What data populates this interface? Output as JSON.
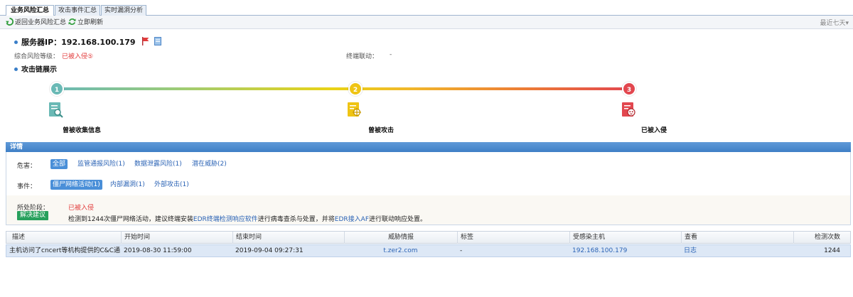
{
  "tabs": [
    {
      "label": "业务风险汇总",
      "active": true
    },
    {
      "label": "攻击事件汇总",
      "active": false
    },
    {
      "label": "实时漏洞分析",
      "active": false
    }
  ],
  "toolbar": {
    "back_label": "返回业务风险汇总",
    "refresh_label": "立即刷新",
    "range_label": "最近七天▾"
  },
  "server": {
    "title_prefix": "服务器IP：",
    "ip": "192.168.100.179",
    "risk_label": "综合风险等级：",
    "risk_value": "已被入侵⑤",
    "terminal_label": "终端联动：",
    "terminal_value": "-"
  },
  "attack_chain": {
    "title": "攻击链展示",
    "stages": [
      {
        "num": "1",
        "label": "曾被收集信息",
        "color": "#6ab9b5"
      },
      {
        "num": "2",
        "label": "曾被攻击",
        "color": "#efc414"
      },
      {
        "num": "3",
        "label": "已被入侵",
        "color": "#e2474f"
      }
    ]
  },
  "details": {
    "header": "详情",
    "harm_label": "危害：",
    "harm_options": [
      "全部",
      "监管通报风险(1)",
      "数据泄露风险(1)",
      "潜在威胁(2)"
    ],
    "event_label": "事件：",
    "event_options": [
      "僵尸网络活动(1)",
      "内部漏洞(1)",
      "外部攻击(1)"
    ],
    "stage_label": "所处阶段：",
    "stage_value": "已被入侵",
    "advice_button": "解决建议",
    "advice_text_1": "检测到1244次僵尸网络活动，建议终端安装",
    "advice_link_1": "EDR终端检测响应软件",
    "advice_text_2": "进行病毒查杀与处置，并将",
    "advice_link_2": "EDR接入AF",
    "advice_text_3": "进行联动响应处置。"
  },
  "table": {
    "columns": [
      "描述",
      "开始时间",
      "结束时间",
      "威胁情报",
      "标签",
      "受感染主机",
      "查看",
      "检测次数"
    ],
    "rows": [
      {
        "desc": "主机访问了cncert等机构提供的C&C通...",
        "start": "2019-08-30 11:59:00",
        "end": "2019-09-04 09:27:31",
        "intel": "t.zer2.com",
        "tag": "-",
        "host": "192.168.100.179",
        "view": "日志",
        "count": "1244"
      }
    ]
  },
  "colors": {
    "accent": "#3f7fc6",
    "danger": "#e23b3b",
    "advice": "#27a05c",
    "link": "#2b63b5"
  }
}
